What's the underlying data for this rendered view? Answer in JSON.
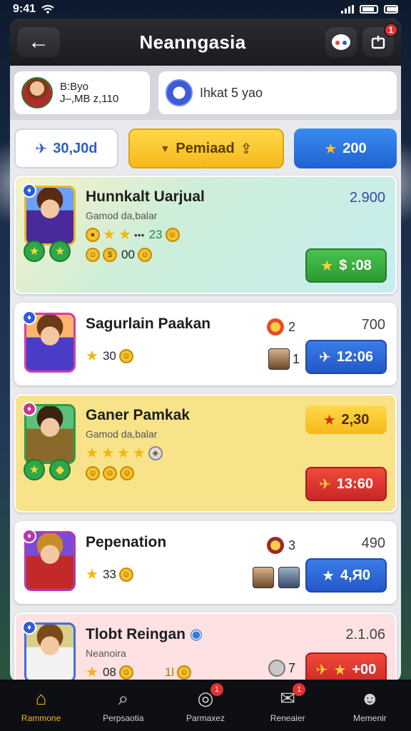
{
  "status": {
    "time": "9:41"
  },
  "header": {
    "title": "Neanngasia",
    "notif_count": "1"
  },
  "profile": {
    "line1": "B:Byo",
    "line2": "J–,MB z,110"
  },
  "team": {
    "name": "Ihkat 5 yao"
  },
  "filters": {
    "left": "30,J0d",
    "middle": "Pemiaad",
    "right": "200"
  },
  "cards": [
    {
      "name": "Hunnkalt Uarjual",
      "sub": "Gamod da,balar",
      "top_right": "2.900",
      "meta_num": "23",
      "coin_num": "00",
      "button": "$ :08"
    },
    {
      "name": "Sagurlain Paakan",
      "top_right": "700",
      "meta_num": "2",
      "rating": "30",
      "mini_num": "1",
      "button": "12:06"
    },
    {
      "name": "Ganer Pamkak",
      "sub": "Gamod da,balar",
      "pill": "2,30",
      "button": "13:60"
    },
    {
      "name": "Pepenation",
      "top_right": "490",
      "meta_num": "3",
      "rating": "33",
      "button": "4,Я0"
    },
    {
      "name": "Tlobt Reingan",
      "sub": "Neanoira",
      "top_right": "2.1.06",
      "rating": "08",
      "coin_num": "1l",
      "meta_num": "7",
      "button": "+00"
    }
  ],
  "tabs": [
    {
      "label": "Rammone",
      "icon": "home-icon"
    },
    {
      "label": "Perpsaotia",
      "icon": "search-icon"
    },
    {
      "label": "Parmaxez",
      "icon": "camera-icon",
      "badge": "1"
    },
    {
      "label": "Reneaier",
      "icon": "chat-icon",
      "badge": "1"
    },
    {
      "label": "Memenir",
      "icon": "user-icon"
    }
  ]
}
